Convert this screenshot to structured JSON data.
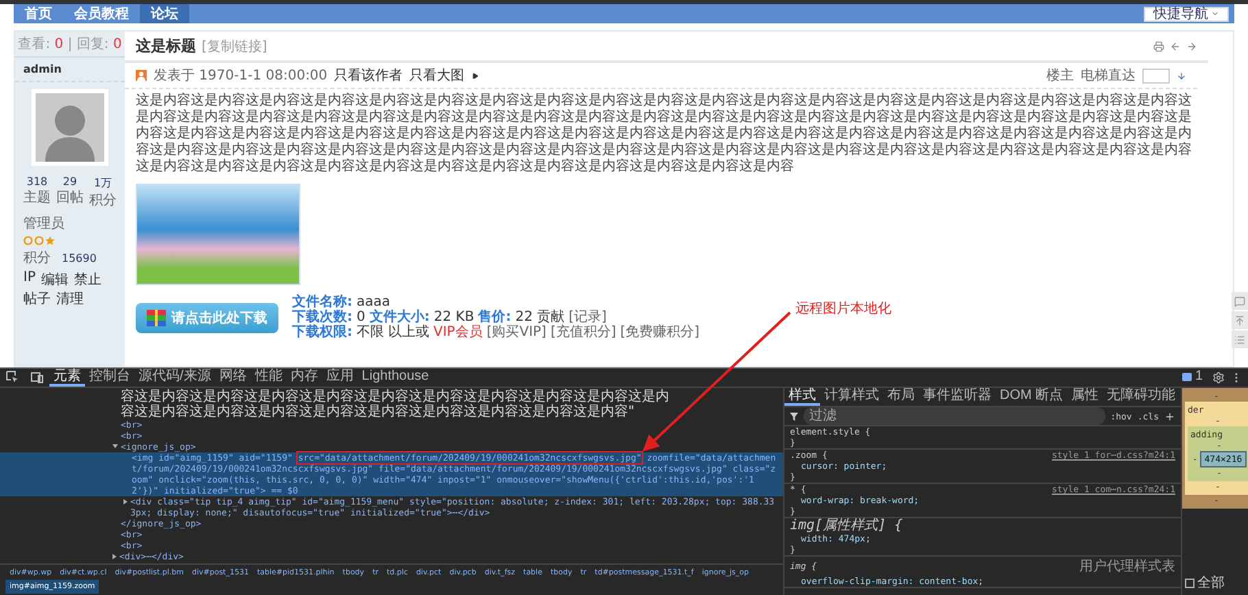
{
  "nav": {
    "items": [
      {
        "label": "首页",
        "selected": false
      },
      {
        "label": "会员教程",
        "selected": false
      },
      {
        "label": "论坛",
        "selected": true
      }
    ],
    "quick_nav": "快捷导航"
  },
  "sidebar": {
    "views_label": "查看:",
    "views": "0",
    "separator": "|",
    "replies_label": "回复:",
    "replies": "0",
    "username": "admin",
    "stats": [
      {
        "value": "318",
        "label": "主题"
      },
      {
        "value": "29",
        "label": "回帖"
      },
      {
        "value": "1万",
        "label": "积分"
      }
    ],
    "group": "管理员",
    "points_label": "积分",
    "points": "15690",
    "actions": [
      "IP",
      "编辑",
      "禁止",
      "帖子",
      "清理"
    ]
  },
  "thread": {
    "title": "这是标题",
    "copy_link": "[复制链接]",
    "posted": "发表于 1970-1-1 08:00:00",
    "filters": [
      "只看该作者",
      "只看大图"
    ],
    "floor": "楼主",
    "jump_label": "电梯直达",
    "content": "这是内容这是内容这是内容这是内容这是内容这是内容这是内容这是内容这是内容这是内容这是内容这是内容这是内容这是内容这是内容这是内容这是内容这是内容这是内容这是内容这是内容这是内容这是内容这是内容这是内容这是内容这是内容这是内容这是内容这是内容这是内容这是内容这是内容这是内容这是内容这是内容这是内容这是内容这是内容这是内容这是内容这是内容这是内容这是内容这是内容这是内容这是内容这是内容这是内容这是内容这是内容这是内容这是内容这是内容这是内容这是内容这是内容这是内容这是内容这是内容这是内容这是内容这是内容这是内容这是内容这是内容这是内容这是内容这是内容这是内容这是内容这是内容这是内容这是内容这是内容这是内容这是内容这是内容这是内容这是内容这是内容这是内容这是内容这是内容这是内容这是内容这是内容这是内容这是内容",
    "download": {
      "button": "请点击此处下载",
      "lines": [
        {
          "items": [
            {
              "kind": "label",
              "text": "文件名称:"
            },
            {
              "kind": "value",
              "text": "aaaa"
            }
          ]
        },
        {
          "items": [
            {
              "kind": "label",
              "text": "下载次数:"
            },
            {
              "kind": "value",
              "text": "0"
            },
            {
              "kind": "label",
              "text": "文件大小:"
            },
            {
              "kind": "value",
              "text": "22 KB"
            },
            {
              "kind": "label",
              "text": "售价:"
            },
            {
              "kind": "value",
              "text": "22 贡献"
            },
            {
              "kind": "link",
              "text": "[记录]"
            }
          ]
        },
        {
          "items": [
            {
              "kind": "label",
              "text": "下载权限:"
            },
            {
              "kind": "value",
              "text": "不限"
            },
            {
              "kind": "value",
              "text": "以上或"
            },
            {
              "kind": "vip",
              "text": "VIP会员"
            },
            {
              "kind": "link",
              "text": "[购买VIP]"
            },
            {
              "kind": "link",
              "text": "[充值积分]"
            },
            {
              "kind": "link",
              "text": "[免费赚积分]"
            }
          ]
        }
      ]
    }
  },
  "annotation": "远程图片本地化",
  "devtools": {
    "tabs": [
      {
        "label": "元素",
        "selected": true
      },
      {
        "label": "控制台",
        "selected": false
      },
      {
        "label": "源代码/来源",
        "selected": false
      },
      {
        "label": "网络",
        "selected": false
      },
      {
        "label": "性能",
        "selected": false
      },
      {
        "label": "内存",
        "selected": false
      },
      {
        "label": "应用",
        "selected": false
      },
      {
        "label": "Lighthouse",
        "selected": false
      }
    ],
    "issues": "1",
    "nodes": [
      {
        "kind": "text",
        "text": "容这是内容这是内容这是内容这是内容这是内容这是内容这是内容这是内容这是内容这是内容这是内容这是内容这是内容这是内容这是内容这是内容这是内容这是内容这是内容\""
      },
      {
        "kind": "tag",
        "text": "<br>"
      },
      {
        "kind": "tag",
        "text": "<br>"
      },
      {
        "kind": "tag",
        "text": "<ignore_js_op>",
        "expanded": true,
        "close": "</ignore_js_op>",
        "children": [
          {
            "kind": "selected",
            "before": "<img id=\"aimg_1159\" aid=\"1159\" ",
            "highlight": "src=\"data/attachment/forum/202409/19/000241om32ncscxfswgsvs.jpg\"",
            "after": " zoomfile=\"data/attachment/forum/202409/19/000241om32ncscxfswgsvs.jpg\" file=\"data/attachment/forum/202409/19/000241om32ncscxfswgsvs.jpg\" class=\"zoom\" onclick=\"zoom(this, this.src, 0, 0, 0)\" width=\"474\" inpost=\"1\" onmouseover=\"showMenu({'ctrlid':this.id,'pos':'12'})\" initialized=\"true\"> == $0"
          },
          {
            "kind": "tag",
            "text": "<div class=\"tip tip_4 aimg_tip\" id=\"aimg_1159_menu\" style=\"position: absolute; z-index: 301; left: 203.28px; top: 388.333px; display: none;\" disautofocus=\"true\" initialized=\"true\">⋯</div>",
            "expanded": false
          }
        ]
      },
      {
        "kind": "tag",
        "text": "<br>"
      },
      {
        "kind": "tag",
        "text": "<br>"
      },
      {
        "kind": "tag",
        "text": "<div>⋯</div>",
        "expanded": false
      }
    ],
    "breadcrumb": [
      {
        "label": "div#wp.wp",
        "selected": false
      },
      {
        "label": "div#ct.wp.cl",
        "selected": false
      },
      {
        "label": "div#postlist.pl.bm",
        "selected": false
      },
      {
        "label": "div#post_1531",
        "selected": false
      },
      {
        "label": "table#pid1531.plhin",
        "selected": false
      },
      {
        "label": "tbody",
        "selected": false
      },
      {
        "label": "tr",
        "selected": false
      },
      {
        "label": "td.plc",
        "selected": false
      },
      {
        "label": "div.pct",
        "selected": false
      },
      {
        "label": "div.pcb",
        "selected": false
      },
      {
        "label": "div.t_fsz",
        "selected": false
      },
      {
        "label": "table",
        "selected": false
      },
      {
        "label": "tbody",
        "selected": false
      },
      {
        "label": "tr",
        "selected": false
      },
      {
        "label": "td#postmessage_1531.t_f",
        "selected": false
      },
      {
        "label": "ignore_js_op",
        "selected": false
      },
      {
        "label": "img#aimg_1159.zoom",
        "selected": true
      }
    ],
    "style_tabs": [
      {
        "label": "样式",
        "selected": true
      },
      {
        "label": "计算样式",
        "selected": false
      },
      {
        "label": "布局",
        "selected": false
      },
      {
        "label": "事件监听器",
        "selected": false
      },
      {
        "label": "DOM 断点",
        "selected": false
      },
      {
        "label": "属性",
        "selected": false
      },
      {
        "label": "无障碍功能",
        "selected": false
      }
    ],
    "filter": {
      "placeholder": "过滤"
    },
    "hov": ":hov",
    "cls": ".cls",
    "rules": [
      {
        "kind": "normal",
        "selector": "element.style {",
        "close": "}"
      },
      {
        "kind": "normal",
        "selector": ".zoom {",
        "source": "style_1_for⋯d.css?m24:1",
        "decls": [
          "cursor: pointer;"
        ],
        "close": "}"
      },
      {
        "kind": "normal",
        "selector": "* {",
        "source": "style_1_com⋯n.css?m24:1",
        "decls": [
          "word-wrap: break-word;"
        ],
        "close": "}"
      },
      {
        "kind": "attr",
        "selector": "img[属性样式] {",
        "decls": [
          "width: 474px;"
        ],
        "close": "}"
      },
      {
        "kind": "ua",
        "selector": "img {",
        "source": "用户代理样式表",
        "decls": [
          "overflow-clip-margin: content-box;"
        ]
      }
    ],
    "box_model": {
      "margin": "-",
      "border_label": "der",
      "border": "-",
      "padding_label": "adding",
      "padding": "-",
      "padding_left": "-",
      "content": "474×216",
      "padding_bottom": "-",
      "border_bottom": "-",
      "margin_bottom": "-"
    },
    "show_all": {
      "label": "全部",
      "checked": false
    }
  }
}
